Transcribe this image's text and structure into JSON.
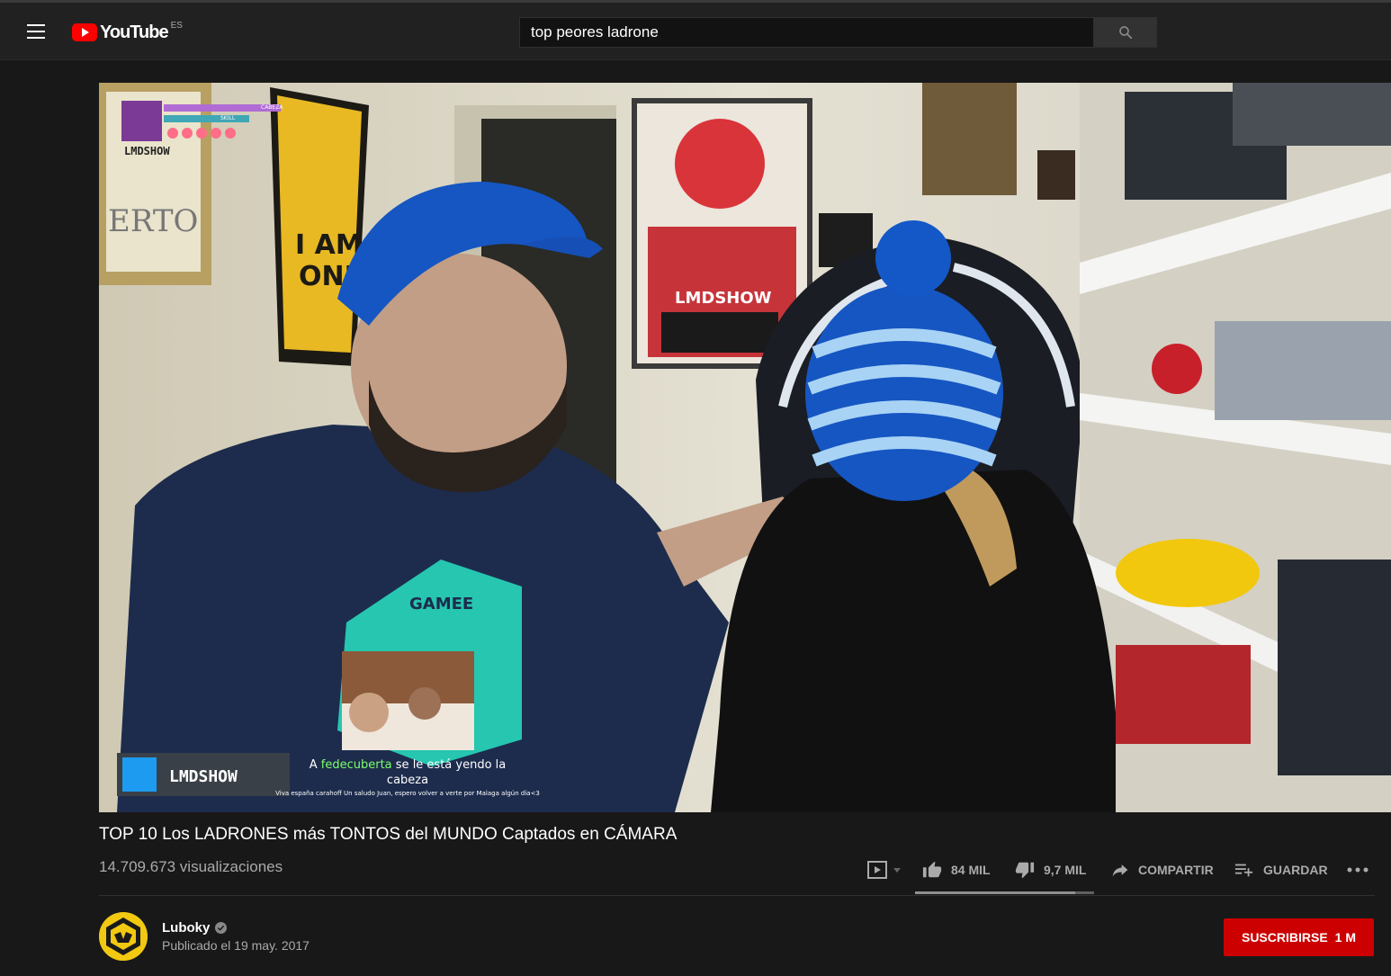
{
  "header": {
    "logo_text": "YouTube",
    "country_code": "ES",
    "search_value": "top peores ladrone"
  },
  "video": {
    "overlay": {
      "hud_name": "LMDSHOW",
      "hud_bar1": "CABEZA",
      "hud_bar2": "SKILL",
      "social_handle": "LMDSHOW",
      "chat_prefix": "A ",
      "chat_user": "fedecuberta",
      "chat_line1": " se le está yendo la",
      "chat_line2": "cabeza",
      "chat_sub": "Viva españa carahoff Un saludo Juan, espero volver a verte por Malaga algún día<3",
      "poster_text": "LMDSHOW"
    },
    "title": "TOP 10 Los LADRONES más TONTOS del MUNDO Captados en CÁMARA",
    "views": "14.709.673 visualizaciones",
    "likes": "84 MIL",
    "dislikes": "9,7 MIL",
    "share_label": "COMPARTIR",
    "save_label": "GUARDAR",
    "like_ratio": 0.896
  },
  "channel": {
    "name": "Luboky",
    "published": "Publicado el 19 may. 2017",
    "subscribe_label": "SUSCRIBIRSE",
    "subscriber_count": "1 M"
  },
  "colors": {
    "brand_red": "#ff0000",
    "subscribe_red": "#cc0000",
    "background": "#181818",
    "masthead": "#212121"
  },
  "icons": [
    "menu-icon",
    "youtube-logo-icon",
    "search-icon",
    "add-to-playlist-icon",
    "thumb-up-icon",
    "thumb-down-icon",
    "share-icon",
    "save-icon",
    "more-icon",
    "verified-icon"
  ]
}
